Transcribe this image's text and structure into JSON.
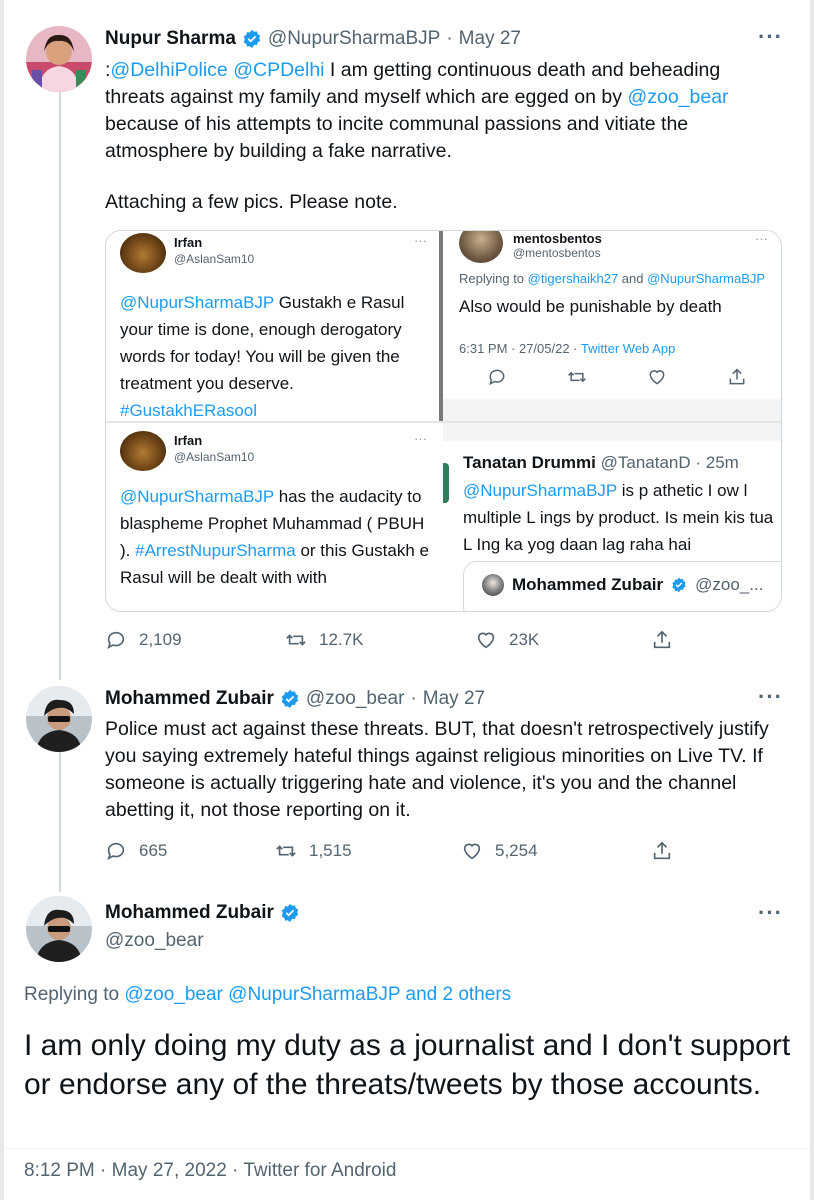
{
  "tweet1": {
    "name": "Nupur Sharma",
    "handle": "@NupurSharmaBJP",
    "sep": "·",
    "date": "May 27",
    "more": "···",
    "text_prefix": ":",
    "mention1": "@DelhiPolice",
    "mention2": "@CPDelhi",
    "text_a": " I am getting continuous death and beheading threats against my family and myself which are egged on by ",
    "mention3": "@zoo_bear",
    "text_b": " because of his attempts to incite communal passions and vitiate the atmosphere by building a fake narrative.",
    "text_c": "Attaching a few pics. Please note.",
    "actions": {
      "replies": "2,109",
      "retweets": "12.7K",
      "likes": "23K"
    }
  },
  "media": {
    "panel1": {
      "name": "Irfan",
      "handle": "@AslanSam10",
      "mention": "@NupurSharmaBJP",
      "text": " Gustakh e Rasul your time is done, enough derogatory words for today! You will be given the treatment you deserve.",
      "hashtag": "#GustakhERasool"
    },
    "panel2": {
      "name": "mentosbentos",
      "handle": "@mentosbentos",
      "replying_prefix": "Replying to ",
      "reply_to1": "@tigershaikh27",
      "reply_and": " and ",
      "reply_to2": "@NupurSharmaBJP",
      "text": "Also would be punishable by death",
      "time": "6:31 PM · 27/05/22 · ",
      "source": "Twitter Web App"
    },
    "panel3": {
      "name": "Irfan",
      "handle": "@AslanSam10",
      "mention": "@NupurSharmaBJP",
      "text_a": " has the audacity to blaspheme Prophet Muhammad ( PBUH ). ",
      "hashtag": "#ArrestNupurSharma",
      "text_b": " or this Gustakh e Rasul will be dealt with with"
    },
    "panel4": {
      "name": "Tanatan Drummi",
      "handle": "@TanatanD",
      "time": "· 25m",
      "mention": "@NupurSharmaBJP",
      "text": " is p athetic I ow l multiple L ings by product. Is mein kis tua L Ing ka yog daan lag raha hai",
      "quoted_name": "Mohammed Zubair",
      "quoted_handle": "@zoo_..."
    }
  },
  "tweet2": {
    "name": "Mohammed Zubair",
    "handle": "@zoo_bear",
    "sep": "·",
    "date": "May 27",
    "more": "···",
    "text": "Police must act against these threats. BUT, that doesn't retrospectively justify you saying extremely hateful things against religious minorities on Live TV. If someone is actually triggering hate and violence, it's you and the channel abetting it, not those reporting on it.",
    "actions": {
      "replies": "665",
      "retweets": "1,515",
      "likes": "5,254"
    }
  },
  "tweet3": {
    "name": "Mohammed Zubair",
    "handle": "@zoo_bear",
    "more": "···",
    "replying_prefix": "Replying to ",
    "reply_to1": "@zoo_bear",
    "reply_to2": "@NupurSharmaBJP",
    "reply_others": "and 2 others",
    "text": "I am only doing my duty as a journalist and I don't support or endorse any of the threats/tweets by those accounts.",
    "meta": "8:12 PM · May 27, 2022 · Twitter for Android"
  },
  "colors": {
    "link": "#1d9bf0",
    "muted": "#536471",
    "verified": "#1d9bf0"
  }
}
